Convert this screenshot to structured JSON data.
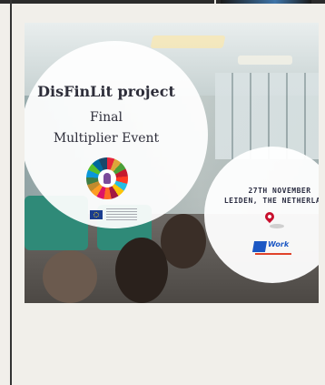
{
  "post": {
    "title": "DisFinLit project",
    "subtitle_line1": "Final",
    "subtitle_line2": "Multiplier Event",
    "date": "27TH NOVEMBER",
    "location": "LEIDEN, THE NETHERLANDS",
    "partner_logo_text": "Work",
    "partner_logo_badge": "2"
  },
  "colors": {
    "page_background": "#f1efea",
    "title_text": "#2e2e3a",
    "map_pin": "#c8102e",
    "logo_blue": "#1b57c4",
    "eu_blue": "#1a3d8f"
  },
  "icons": [
    "sdg-wheel-icon",
    "eu-flag-icon",
    "map-pin-icon",
    "partner-logo"
  ]
}
